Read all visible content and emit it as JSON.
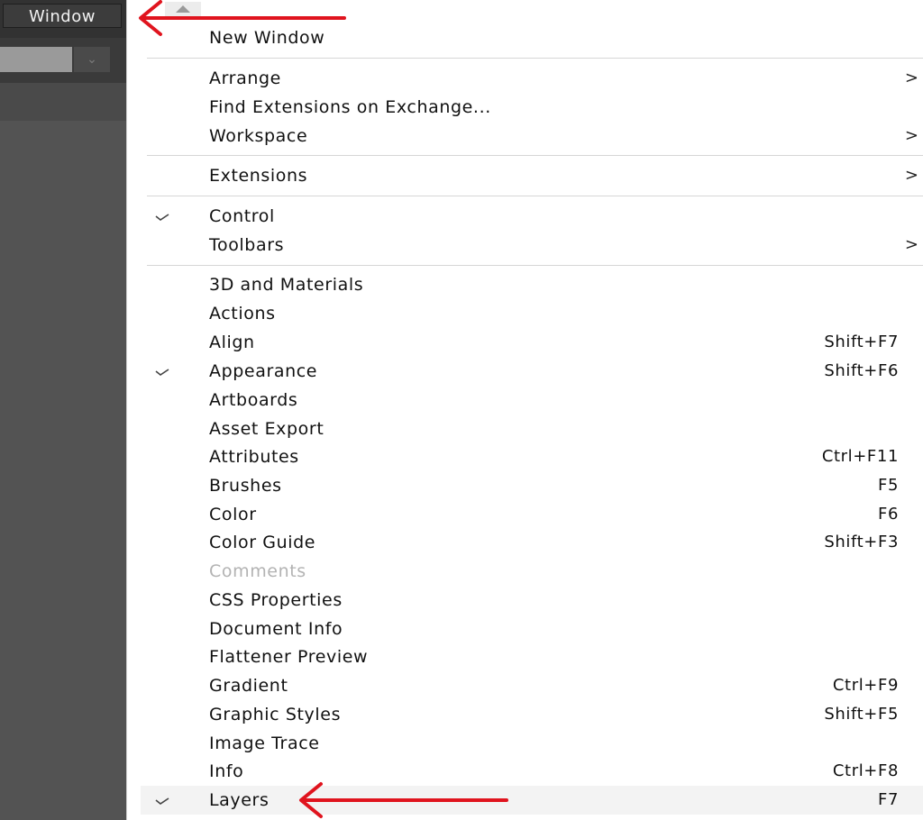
{
  "menubar": {
    "window_menu_label": "Window"
  },
  "control_bar": {
    "dropdown_icon": "chevron-down-icon"
  },
  "menu": {
    "scroll_up_icon": "scroll-up-arrow-icon",
    "items": [
      {
        "label": "New Window",
        "shortcut": "",
        "checked": false,
        "submenu": false,
        "disabled": false
      },
      {
        "label": "Arrange",
        "shortcut": "",
        "checked": false,
        "submenu": true,
        "disabled": false
      },
      {
        "label": "Find Extensions on Exchange...",
        "shortcut": "",
        "checked": false,
        "submenu": false,
        "disabled": false
      },
      {
        "label": "Workspace",
        "shortcut": "",
        "checked": false,
        "submenu": true,
        "disabled": false
      },
      {
        "label": "Extensions",
        "shortcut": "",
        "checked": false,
        "submenu": true,
        "disabled": false
      },
      {
        "label": "Control",
        "shortcut": "",
        "checked": true,
        "submenu": false,
        "disabled": false
      },
      {
        "label": "Toolbars",
        "shortcut": "",
        "checked": false,
        "submenu": true,
        "disabled": false
      },
      {
        "label": "3D and Materials",
        "shortcut": "",
        "checked": false,
        "submenu": false,
        "disabled": false
      },
      {
        "label": "Actions",
        "shortcut": "",
        "checked": false,
        "submenu": false,
        "disabled": false
      },
      {
        "label": "Align",
        "shortcut": "Shift+F7",
        "checked": false,
        "submenu": false,
        "disabled": false
      },
      {
        "label": "Appearance",
        "shortcut": "Shift+F6",
        "checked": true,
        "submenu": false,
        "disabled": false
      },
      {
        "label": "Artboards",
        "shortcut": "",
        "checked": false,
        "submenu": false,
        "disabled": false
      },
      {
        "label": "Asset Export",
        "shortcut": "",
        "checked": false,
        "submenu": false,
        "disabled": false
      },
      {
        "label": "Attributes",
        "shortcut": "Ctrl+F11",
        "checked": false,
        "submenu": false,
        "disabled": false
      },
      {
        "label": "Brushes",
        "shortcut": "F5",
        "checked": false,
        "submenu": false,
        "disabled": false
      },
      {
        "label": "Color",
        "shortcut": "F6",
        "checked": false,
        "submenu": false,
        "disabled": false
      },
      {
        "label": "Color Guide",
        "shortcut": "Shift+F3",
        "checked": false,
        "submenu": false,
        "disabled": false
      },
      {
        "label": "Comments",
        "shortcut": "",
        "checked": false,
        "submenu": false,
        "disabled": true
      },
      {
        "label": "CSS Properties",
        "shortcut": "",
        "checked": false,
        "submenu": false,
        "disabled": false
      },
      {
        "label": "Document Info",
        "shortcut": "",
        "checked": false,
        "submenu": false,
        "disabled": false
      },
      {
        "label": "Flattener Preview",
        "shortcut": "",
        "checked": false,
        "submenu": false,
        "disabled": false
      },
      {
        "label": "Gradient",
        "shortcut": "Ctrl+F9",
        "checked": false,
        "submenu": false,
        "disabled": false
      },
      {
        "label": "Graphic Styles",
        "shortcut": "Shift+F5",
        "checked": false,
        "submenu": false,
        "disabled": false
      },
      {
        "label": "Image Trace",
        "shortcut": "",
        "checked": false,
        "submenu": false,
        "disabled": false
      },
      {
        "label": "Info",
        "shortcut": "Ctrl+F8",
        "checked": false,
        "submenu": false,
        "disabled": false
      },
      {
        "label": "Layers",
        "shortcut": "F7",
        "checked": true,
        "submenu": false,
        "disabled": false,
        "highlighted": true
      }
    ]
  },
  "annotations": {
    "arrow_color": "#e0141e",
    "arrow_targets": [
      "Window",
      "Layers"
    ]
  }
}
